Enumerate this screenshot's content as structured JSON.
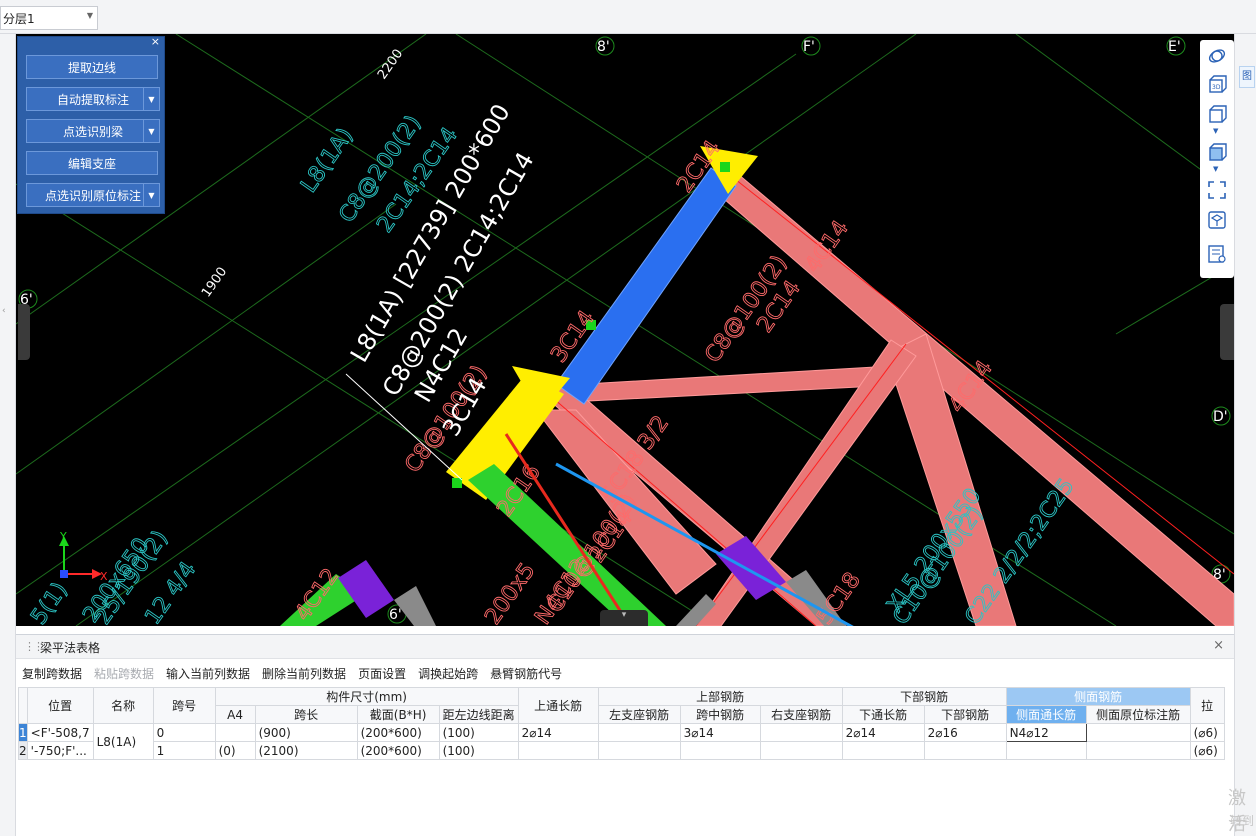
{
  "topbar": {
    "layer_select_value": "分层1"
  },
  "tool_panel": {
    "buttons": [
      {
        "label": "提取边线",
        "dropdown": false
      },
      {
        "label": "自动提取标注",
        "dropdown": true
      },
      {
        "label": "点选识别梁",
        "dropdown": true
      },
      {
        "label": "编辑支座",
        "dropdown": false
      },
      {
        "label": "点选识别原位标注",
        "dropdown": true
      }
    ]
  },
  "cad": {
    "axis_labels": [
      "8'",
      "F'",
      "E'",
      "6'",
      "D'",
      "8'",
      "6'"
    ],
    "dim_texts": [
      "2200",
      "1900"
    ],
    "beam_annotation_lines": [
      "L8(1A) [22739] 200*600",
      "C8@200(2) 2C14;2C14",
      "N4C12",
      "3C14"
    ],
    "red_texts": [
      "2C14",
      "4C14",
      "2C14",
      "C8@100(2)",
      "3C14",
      "4C14",
      "5C18 3/2",
      "2C14",
      "C8@100(2)",
      "2C16",
      "C10@100(2)",
      "N4C12",
      "200x5",
      "4C12",
      "5C18"
    ],
    "cyan_texts": [
      "L8(1A)",
      "C8@200(2)",
      "2C14;2C14",
      "XL5 200x550",
      "C10@100(2)",
      "C22 2/2/2;2C25",
      "200x650",
      "5(1)",
      "25/190(2)",
      "12 4/4"
    ],
    "coordinate_axis": {
      "y": "Y",
      "x": "X"
    }
  },
  "bottom_panel": {
    "title": "梁平法表格",
    "toolbar": [
      {
        "label": "复制跨数据",
        "enabled": true
      },
      {
        "label": "粘贴跨数据",
        "enabled": false
      },
      {
        "label": "输入当前列数据",
        "enabled": true
      },
      {
        "label": "删除当前列数据",
        "enabled": true
      },
      {
        "label": "页面设置",
        "enabled": true
      },
      {
        "label": "调换起始跨",
        "enabled": true
      },
      {
        "label": "悬臂钢筋代号",
        "enabled": true
      }
    ],
    "header_groups": {
      "position": "位置",
      "name": "名称",
      "span_no": "跨号",
      "member_size": "构件尺寸(mm)",
      "top_through": "上通长筋",
      "top_rebar": "上部钢筋",
      "bottom_rebar": "下部钢筋",
      "side_rebar": "侧面钢筋",
      "tie": "拉"
    },
    "sub_headers": {
      "a4": "A4",
      "span_length": "跨长",
      "section": "截面(B*H)",
      "edge_distance": "距左边线距离",
      "left_support": "左支座钢筋",
      "mid_span": "跨中钢筋",
      "right_support": "右支座钢筋",
      "bottom_through": "下通长筋",
      "bottom_bars": "下部钢筋",
      "side_through": "侧面通长筋",
      "side_in_situ": "侧面原位标注筋"
    },
    "rows": [
      {
        "no": "1",
        "position": "<F'-508,7",
        "name": "L8(1A)",
        "span": "0",
        "a4": "",
        "span_length": "(900)",
        "section": "(200*600)",
        "edge_distance": "(100)",
        "top_through": "2⌀14",
        "left_support": "",
        "mid_span": "3⌀14",
        "right_support": "",
        "bottom_through": "2⌀14",
        "bottom_bars": "2⌀16",
        "side_through": "N4⌀12",
        "side_in_situ": "",
        "tie": "(⌀6)"
      },
      {
        "no": "2",
        "position": "'-750;F'...",
        "name": "",
        "span": "1",
        "a4": "(0)",
        "span_length": "(2100)",
        "section": "(200*600)",
        "edge_distance": "(100)",
        "top_through": "",
        "left_support": "",
        "mid_span": "",
        "right_support": "",
        "bottom_through": "",
        "bottom_bars": "",
        "side_through": "",
        "side_in_situ": "",
        "tie": "(⌀6)"
      }
    ]
  },
  "watermark": {
    "line1": "激活",
    "line2": "转到"
  }
}
